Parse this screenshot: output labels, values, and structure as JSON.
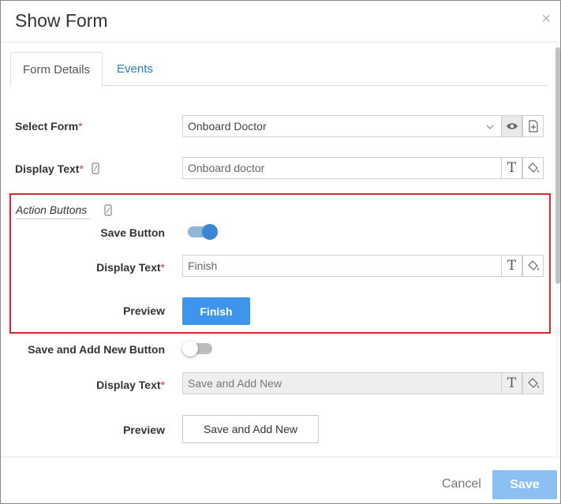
{
  "modal": {
    "title": "Show Form",
    "close_glyph": "×"
  },
  "tabs": [
    {
      "label": "Form Details",
      "active": true
    },
    {
      "label": "Events",
      "active": false
    }
  ],
  "select_form": {
    "label": "Select Form",
    "required_mark": "*",
    "value": "Onboard Doctor",
    "preview_icon": "eye-icon",
    "new_icon": "new-document-icon"
  },
  "display_text": {
    "label": "Display Text",
    "required_mark": "*",
    "value": "Onboard doctor",
    "mobile_icon": "mobile-icon",
    "translate_glyph": "T",
    "style_icon": "paint-bucket-icon"
  },
  "action_buttons": {
    "title": "Action Buttons",
    "save_button": {
      "label": "Save Button",
      "enabled": true,
      "display_text_label": "Display Text",
      "required_mark": "*",
      "display_text_value": "Finish",
      "preview_label": "Preview",
      "preview_button_text": "Finish"
    }
  },
  "save_and_add_new": {
    "label": "Save and Add New Button",
    "enabled": false,
    "display_text_label": "Display Text",
    "required_mark": "*",
    "display_text_value": "Save and Add New",
    "preview_label": "Preview",
    "preview_button_text": "Save and Add New"
  },
  "footer": {
    "cancel_label": "Cancel",
    "save_label": "Save"
  },
  "colors": {
    "accent": "#3d95ec",
    "link": "#2a7fc4",
    "required": "#e03030",
    "highlight_border": "#d9262b",
    "save_disabled": "#8cc0f2"
  }
}
